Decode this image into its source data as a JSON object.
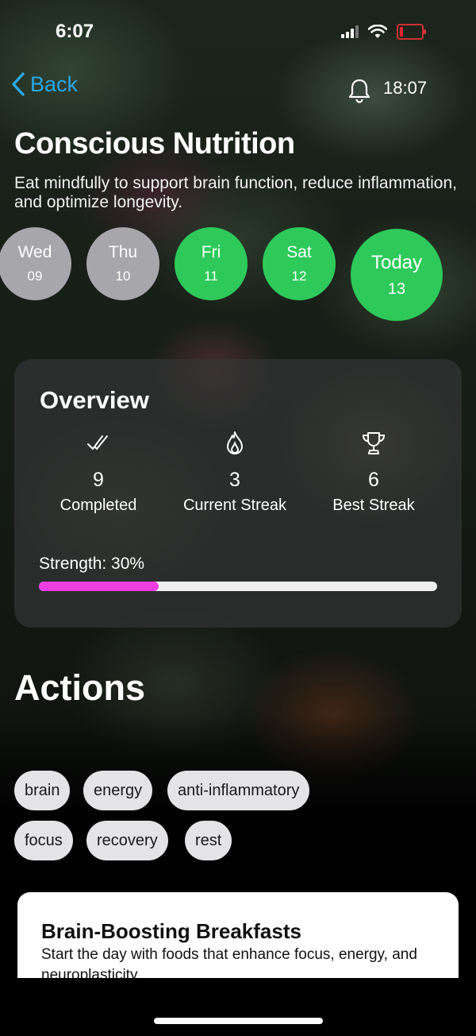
{
  "status_bar": {
    "time": "6:07"
  },
  "nav": {
    "back_label": "Back",
    "time": "18:07"
  },
  "header": {
    "title": "Conscious Nutrition",
    "subtitle": "Eat mindfully to support brain function, reduce inflammation, and optimize longevity."
  },
  "days": [
    {
      "name": "Wed",
      "num": "09",
      "state": "missed"
    },
    {
      "name": "Thu",
      "num": "10",
      "state": "missed"
    },
    {
      "name": "Fri",
      "num": "11",
      "state": "done"
    },
    {
      "name": "Sat",
      "num": "12",
      "state": "done"
    },
    {
      "name": "Today",
      "num": "13",
      "state": "done"
    }
  ],
  "overview": {
    "title": "Overview",
    "stats": [
      {
        "value": "9",
        "label": "Completed",
        "icon": "double-check-icon"
      },
      {
        "value": "3",
        "label": "Current Streak",
        "icon": "flame-icon"
      },
      {
        "value": "6",
        "label": "Best Streak",
        "icon": "trophy-icon"
      }
    ],
    "strength_label": "Strength: 30%",
    "strength_fraction": 0.3
  },
  "actions": {
    "title": "Actions",
    "tags": [
      "brain",
      "energy",
      "anti-inflammatory",
      "focus",
      "recovery",
      "rest"
    ],
    "card": {
      "title": "Brain-Boosting Breakfasts",
      "description": "Start the day with foods that enhance focus, energy, and neuroplasticity."
    }
  },
  "colors": {
    "accent_blue": "#2aa7e8",
    "done_green": "#2ec95a",
    "missed_gray": "#a6a6ab",
    "strength_pink": "#ee3de0"
  }
}
